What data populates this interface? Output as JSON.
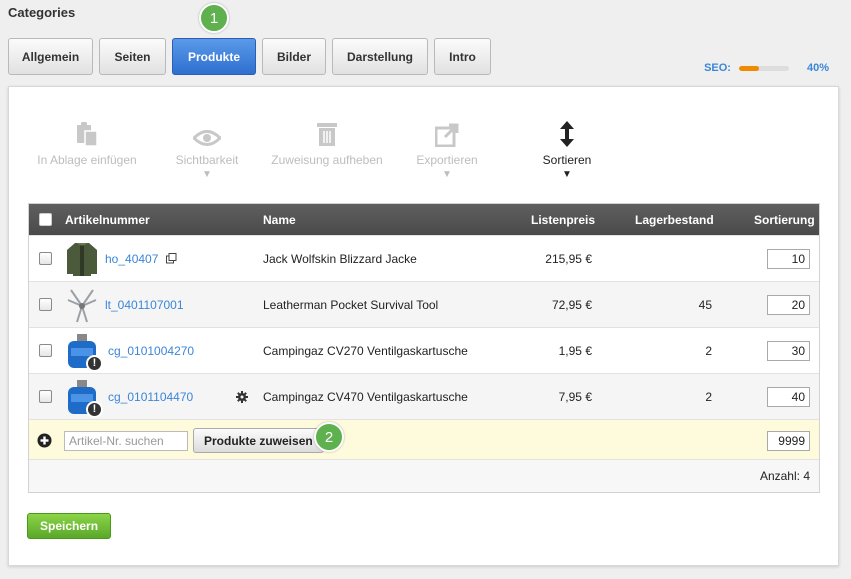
{
  "page": {
    "title": "Categories"
  },
  "tabs": [
    {
      "label": "Allgemein",
      "active": false
    },
    {
      "label": "Seiten",
      "active": false
    },
    {
      "label": "Produkte",
      "active": true
    },
    {
      "label": "Bilder",
      "active": false
    },
    {
      "label": "Darstellung",
      "active": false
    },
    {
      "label": "Intro",
      "active": false
    }
  ],
  "badges": {
    "one": "1",
    "two": "2",
    "color": "#5fb04f"
  },
  "seo": {
    "label": "SEO:",
    "value_text": "40%",
    "fraction": 0.4,
    "fill_color": "#f08a00"
  },
  "toolbar": [
    {
      "label": "In Ablage einfügen",
      "icon": "clipboard-icon",
      "enabled": false,
      "caret": ""
    },
    {
      "label": "Sichtbarkeit",
      "icon": "eye-icon",
      "enabled": false,
      "caret": "▼"
    },
    {
      "label": "Zuweisung aufheben",
      "icon": "trash-icon",
      "enabled": false,
      "caret": ""
    },
    {
      "label": "Exportieren",
      "icon": "export-icon",
      "enabled": false,
      "caret": "▼"
    },
    {
      "label": "Sortieren",
      "icon": "sort-arrows-icon",
      "enabled": true,
      "caret": "▼"
    }
  ],
  "table": {
    "headers": {
      "sku": "Artikelnummer",
      "name": "Name",
      "price": "Listenpreis",
      "stock": "Lagerbestand",
      "sort": "Sortierung"
    },
    "rows": [
      {
        "sku": "ho_40407",
        "name": "Jack Wolfskin Blizzard Jacke",
        "price": "215,95 €",
        "stock": "",
        "sort": "10",
        "thumb": "jacket-thumbnail",
        "warning": false,
        "extra_icon": "external-link-icon"
      },
      {
        "sku": "lt_0401107001",
        "name": "Leatherman Pocket Survival Tool",
        "price": "72,95 €",
        "stock": "45",
        "sort": "20",
        "thumb": "multitool-thumbnail",
        "warning": false,
        "extra_icon": ""
      },
      {
        "sku": "cg_0101004270",
        "name": "Campingaz CV270 Ventilgaskartusche",
        "price": "1,95 €",
        "stock": "2",
        "sort": "30",
        "thumb": "gas-cartridge-thumbnail",
        "warning": true,
        "extra_icon": ""
      },
      {
        "sku": "cg_0101104470",
        "name": "Campingaz CV470 Ventilgaskartusche",
        "price": "7,95 €",
        "stock": "2",
        "sort": "40",
        "thumb": "gas-cartridge-thumbnail",
        "warning": true,
        "extra_icon": "gear-icon"
      }
    ],
    "add_row": {
      "search_placeholder": "Artikel-Nr. suchen",
      "assign_label": "Produkte zuweisen",
      "sort_value": "9999"
    },
    "count": "Anzahl: 4"
  },
  "save_label": "Speichern",
  "colors": {
    "accent_blue": "#3b86d8",
    "active_tab": "#2e6fd0",
    "save_green": "#5aa82a"
  }
}
